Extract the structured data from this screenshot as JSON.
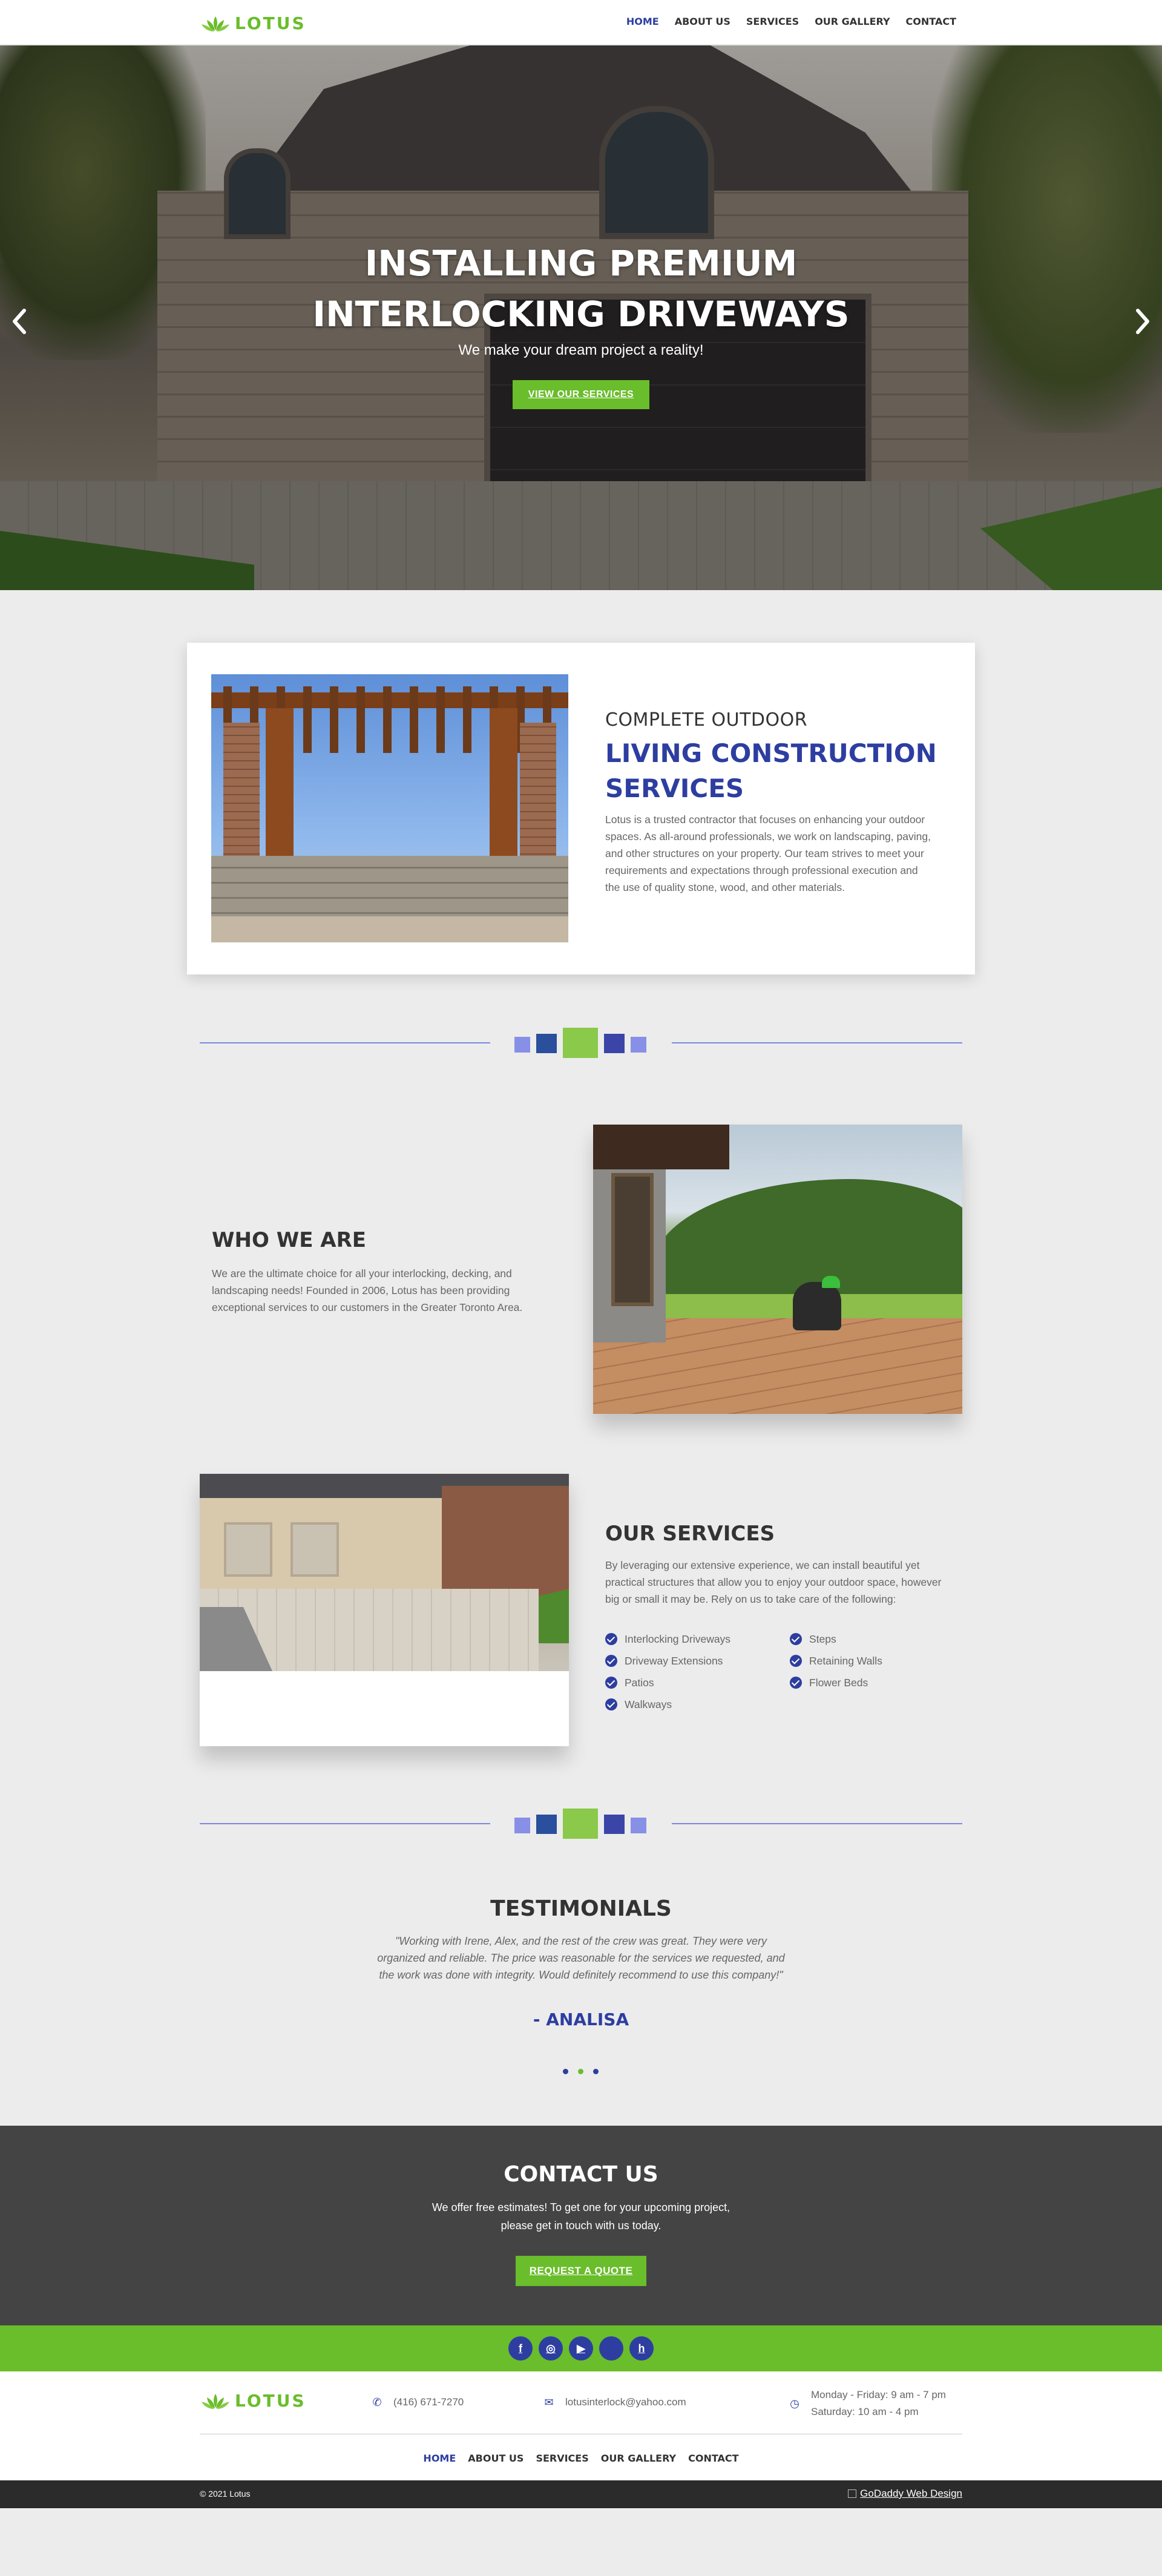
{
  "brand": {
    "name": "LOTUS",
    "color": "#6abd2b",
    "accent": "#2d3ea0"
  },
  "nav": {
    "items": [
      {
        "label": "HOME",
        "active": true
      },
      {
        "label": "ABOUT US",
        "active": false
      },
      {
        "label": "SERVICES",
        "active": false
      },
      {
        "label": "OUR GALLERY",
        "active": false
      },
      {
        "label": "CONTACT",
        "active": false
      }
    ]
  },
  "hero": {
    "title_line1": "INSTALLING PREMIUM",
    "title_line2": "INTERLOCKING DRIVEWAYS",
    "subtitle": "We make your dream project a reality!",
    "button": "VIEW OUR SERVICES",
    "prev_icon": "chevron-left-icon",
    "next_icon": "chevron-right-icon"
  },
  "intro": {
    "eyebrow": "COMPLETE OUTDOOR",
    "title": "LIVING CONSTRUCTION SERVICES",
    "text": "Lotus is a trusted contractor that focuses on enhancing your outdoor spaces. As all-around professionals, we work on landscaping, paving, and other structures on your property. Our team strives to meet your requirements and expectations through professional execution and the use of quality stone, wood, and other materials."
  },
  "who": {
    "title": "WHO WE ARE",
    "text": "We are the ultimate choice for all your interlocking, decking, and landscaping needs! Founded in 2006, Lotus has been providing exceptional services to our customers in the Greater Toronto Area."
  },
  "services": {
    "title": "OUR SERVICES",
    "text": "By leveraging our extensive experience, we can install beautiful yet practical structures that allow you to enjoy your outdoor space, however big or small it may be. Rely on us to take care of the following:",
    "items": [
      "Interlocking Driveways",
      "Steps",
      "Driveway Extensions",
      "Retaining Walls",
      "Patios",
      "Flower Beds",
      "Walkways"
    ]
  },
  "testimonials": {
    "title": "TESTIMONIALS",
    "quote": "\"Working with Irene, Alex, and the rest of the crew was great. They were very organized and reliable. The price was reasonable for the services we requested, and the work was done with integrity. Would definitely recommend to use this company!\"",
    "author": "- ANALISA",
    "dots": 3,
    "active_dot": 2
  },
  "contact": {
    "title": "CONTACT US",
    "text": "We offer free estimates! To get one for your upcoming project, please get in touch with us today.",
    "button": "REQUEST A QUOTE"
  },
  "social": {
    "icons": [
      {
        "name": "facebook-icon",
        "glyph": "f"
      },
      {
        "name": "instagram-icon",
        "glyph": "◎"
      },
      {
        "name": "youtube-icon",
        "glyph": "▶"
      },
      {
        "name": "social-icon",
        "glyph": ""
      },
      {
        "name": "houzz-icon",
        "glyph": "h"
      }
    ]
  },
  "footer": {
    "phone": "(416) 671-7270",
    "email": "lotusinterlock@yahoo.com",
    "hours_line1": "Monday - Friday: 9 am - 7 pm",
    "hours_line2": "Saturday: 10 am - 4 pm",
    "copyright": "© 2021 Lotus",
    "credit": "GoDaddy Web Design"
  }
}
